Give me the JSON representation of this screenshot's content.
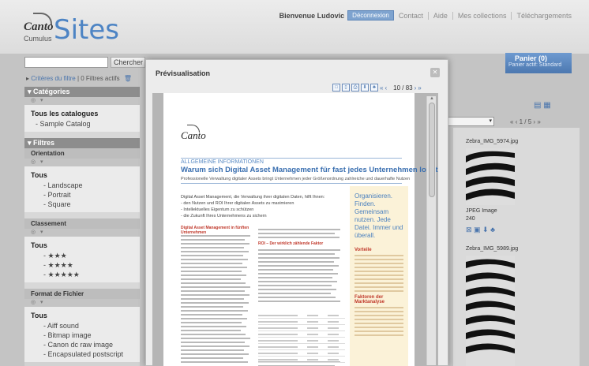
{
  "header": {
    "welcome": "Bienvenue Ludovic",
    "logout": "Déconnexion",
    "nav": [
      "Contact",
      "Aide",
      "Mes collections",
      "Téléchargements"
    ],
    "logo_brand": "Canto",
    "logo_product": "Cumulus",
    "logo_title": "Sites"
  },
  "search": {
    "value": "",
    "button_label": "Chercher"
  },
  "criteria": {
    "link": "Critères du filtre",
    "text": "| 0 Filtres actifs"
  },
  "sidebar": {
    "categories_title": "Catégories",
    "catalogs_title": "Tous les catalogues",
    "catalog_item": "- Sample Catalog",
    "filters_title": "Filtres",
    "orientation_title": "Orientation",
    "orientation_all": "Tous",
    "orientation_items": [
      "- Landscape",
      "- Portrait",
      "- Square"
    ],
    "rating_title": "Classement",
    "rating_all": "Tous",
    "rating_items": [
      "- ★★★",
      "- ★★★★",
      "- ★★★★★"
    ],
    "format_title": "Format de Fichier",
    "format_all": "Tous",
    "format_items": [
      "- Aiff sound",
      "- Bitmap image",
      "- Canon dc raw image",
      "- Encapsulated postscript"
    ]
  },
  "panier": {
    "title": "Panier (0)",
    "subtitle": "Panier actif: Standard"
  },
  "results": {
    "pager": "1 / 5",
    "thumbs": [
      {
        "label": "Zebra_IMG_5974.jpg",
        "type": "JPEG Image",
        "count": "240"
      },
      {
        "label": "Zebra_IMG_5989.jpg"
      }
    ]
  },
  "modal": {
    "title": "Prévisualisation",
    "page_indicator": "10 / 83"
  },
  "document": {
    "brand": "Canto",
    "kicker": "ALLGEMEINE INFORMATIONEN",
    "title": "Warum sich Digital Asset Management für fast jedes Unternehmen lohnt",
    "subtitle": "Professionelle Verwaltung digitaler Assets bringt Unternehmen jeder Größenordnung zahlreiche und dauerhafte Nutzen",
    "intro": "Digital Asset Management, die Verwaltung ihrer digitalen Daten, hilft Ihnen:",
    "bullets": [
      "- den Nutzen und ROI Ihrer digitalen Assets zu maximieren",
      "- Intellektuelles Eigentum zu schützen",
      "- die Zukunft Ihres Unternehmens zu sichern"
    ],
    "section_left": "Digital Asset Management in fünften Unternehmen",
    "section_mid": "ROI – Der wirklich zählende Faktor",
    "sidebox_head": "Organisieren. Finden. Gemeinsam nutzen. Jede Datei. Immer und überall.",
    "sidebox_red1": "Vorteile",
    "sidebox_red2": "Faktoren der Marktanalyse"
  },
  "colors": {
    "accent": "#4d84c4",
    "header_bg": "#e6e6e6",
    "section_head": "#8d8d8d",
    "doc_title": "#3a6fb0",
    "doc_red": "#c0392b",
    "sidebox": "#fbf2d8"
  }
}
